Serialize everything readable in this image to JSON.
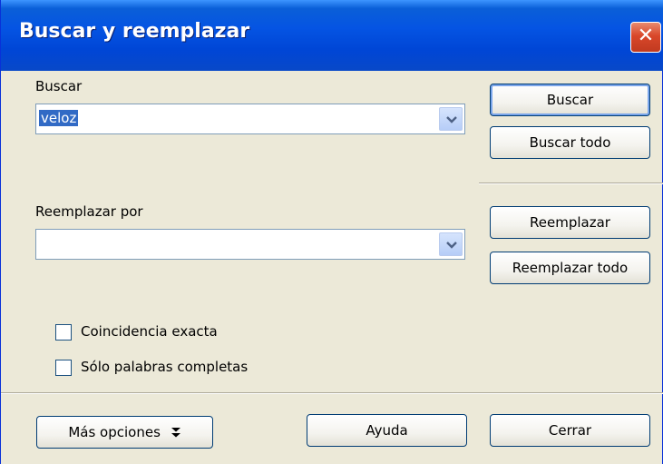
{
  "window": {
    "title": "Buscar y reemplazar",
    "close_glyph": "✕"
  },
  "find": {
    "label": "Buscar",
    "value": "veloz"
  },
  "replace": {
    "label": "Reemplazar por",
    "value": ""
  },
  "buttons": {
    "find": "Buscar",
    "find_all": "Buscar todo",
    "replace": "Reemplazar",
    "replace_all": "Reemplazar todo",
    "more_options": "Más opciones",
    "more_options_icon": "double-chevron-down-icon",
    "help": "Ayuda",
    "close": "Cerrar"
  },
  "options": [
    {
      "label": "Coincidencia exacta",
      "checked": false
    },
    {
      "label": "Sólo palabras completas",
      "checked": false
    }
  ]
}
